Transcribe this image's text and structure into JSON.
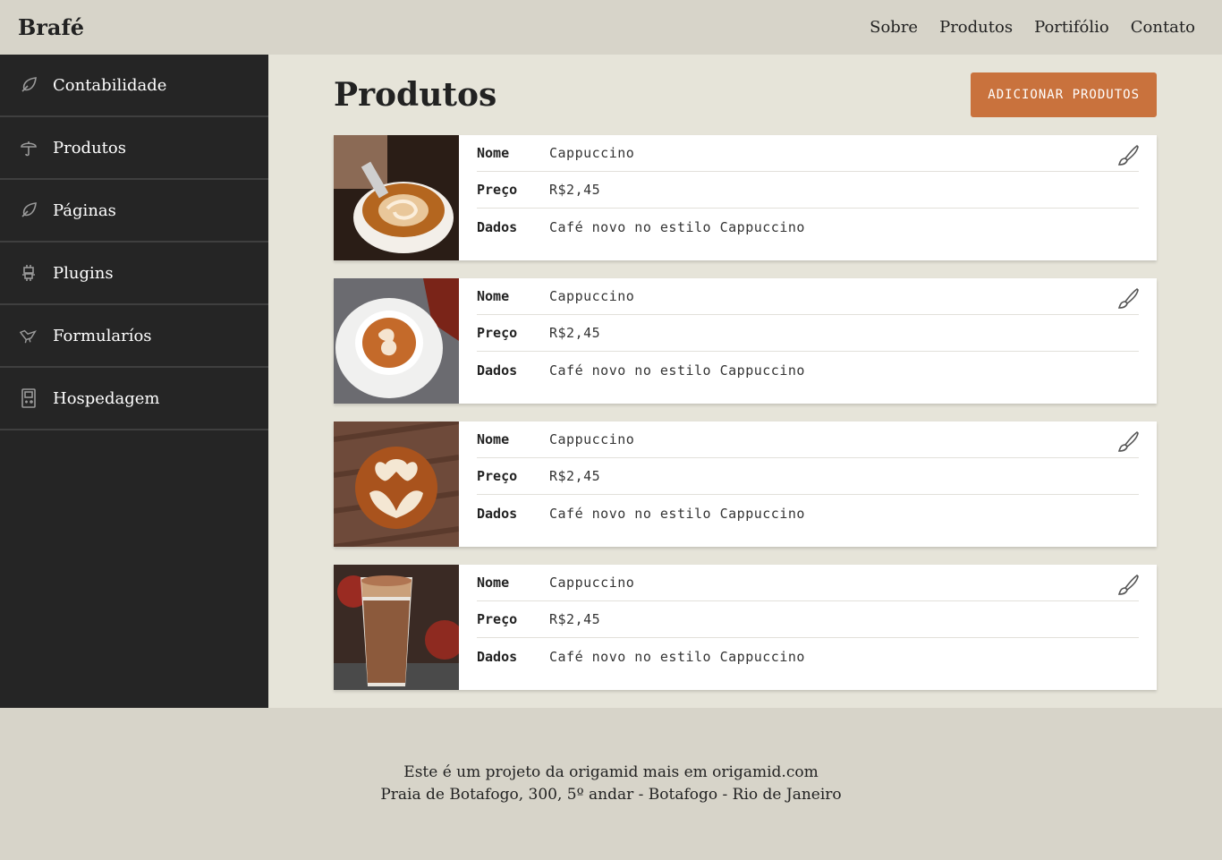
{
  "header": {
    "logo": "Brafé",
    "nav": [
      "Sobre",
      "Produtos",
      "Portifólio",
      "Contato"
    ]
  },
  "sidebar": {
    "items": [
      {
        "label": "Contabilidade",
        "icon": "leaf-icon"
      },
      {
        "label": "Produtos",
        "icon": "umbrella-icon"
      },
      {
        "label": "Páginas",
        "icon": "leaf-icon"
      },
      {
        "label": "Plugins",
        "icon": "robot-icon"
      },
      {
        "label": "Formularíos",
        "icon": "bird-icon"
      },
      {
        "label": "Hospedagem",
        "icon": "gameboy-icon"
      }
    ]
  },
  "main": {
    "title": "Produtos",
    "add_button": "ADICIONAR PRODUTOS",
    "products": [
      {
        "nome_label": "Nome",
        "nome": "Cappuccino",
        "preco_label": "Preço",
        "preco": "R$2,45",
        "dados_label": "Dados",
        "dados": "Café novo no estilo Cappuccino"
      },
      {
        "nome_label": "Nome",
        "nome": "Cappuccino",
        "preco_label": "Preço",
        "preco": "R$2,45",
        "dados_label": "Dados",
        "dados": "Café novo no estilo Cappuccino"
      },
      {
        "nome_label": "Nome",
        "nome": "Cappuccino",
        "preco_label": "Preço",
        "preco": "R$2,45",
        "dados_label": "Dados",
        "dados": "Café novo no estilo Cappuccino"
      },
      {
        "nome_label": "Nome",
        "nome": "Cappuccino",
        "preco_label": "Preço",
        "preco": "R$2,45",
        "dados_label": "Dados",
        "dados": "Café novo no estilo Cappuccino"
      }
    ]
  },
  "footer": {
    "line1": "Este é um projeto da origamid mais em origamid.com",
    "line2": "Praia de Botafogo, 300, 5º andar - Botafogo - Rio de Janeiro"
  },
  "colors": {
    "accent": "#c9723d",
    "sidebar_bg": "#252525",
    "header_bg": "#d7d4c9",
    "main_bg": "#e6e4d9"
  }
}
